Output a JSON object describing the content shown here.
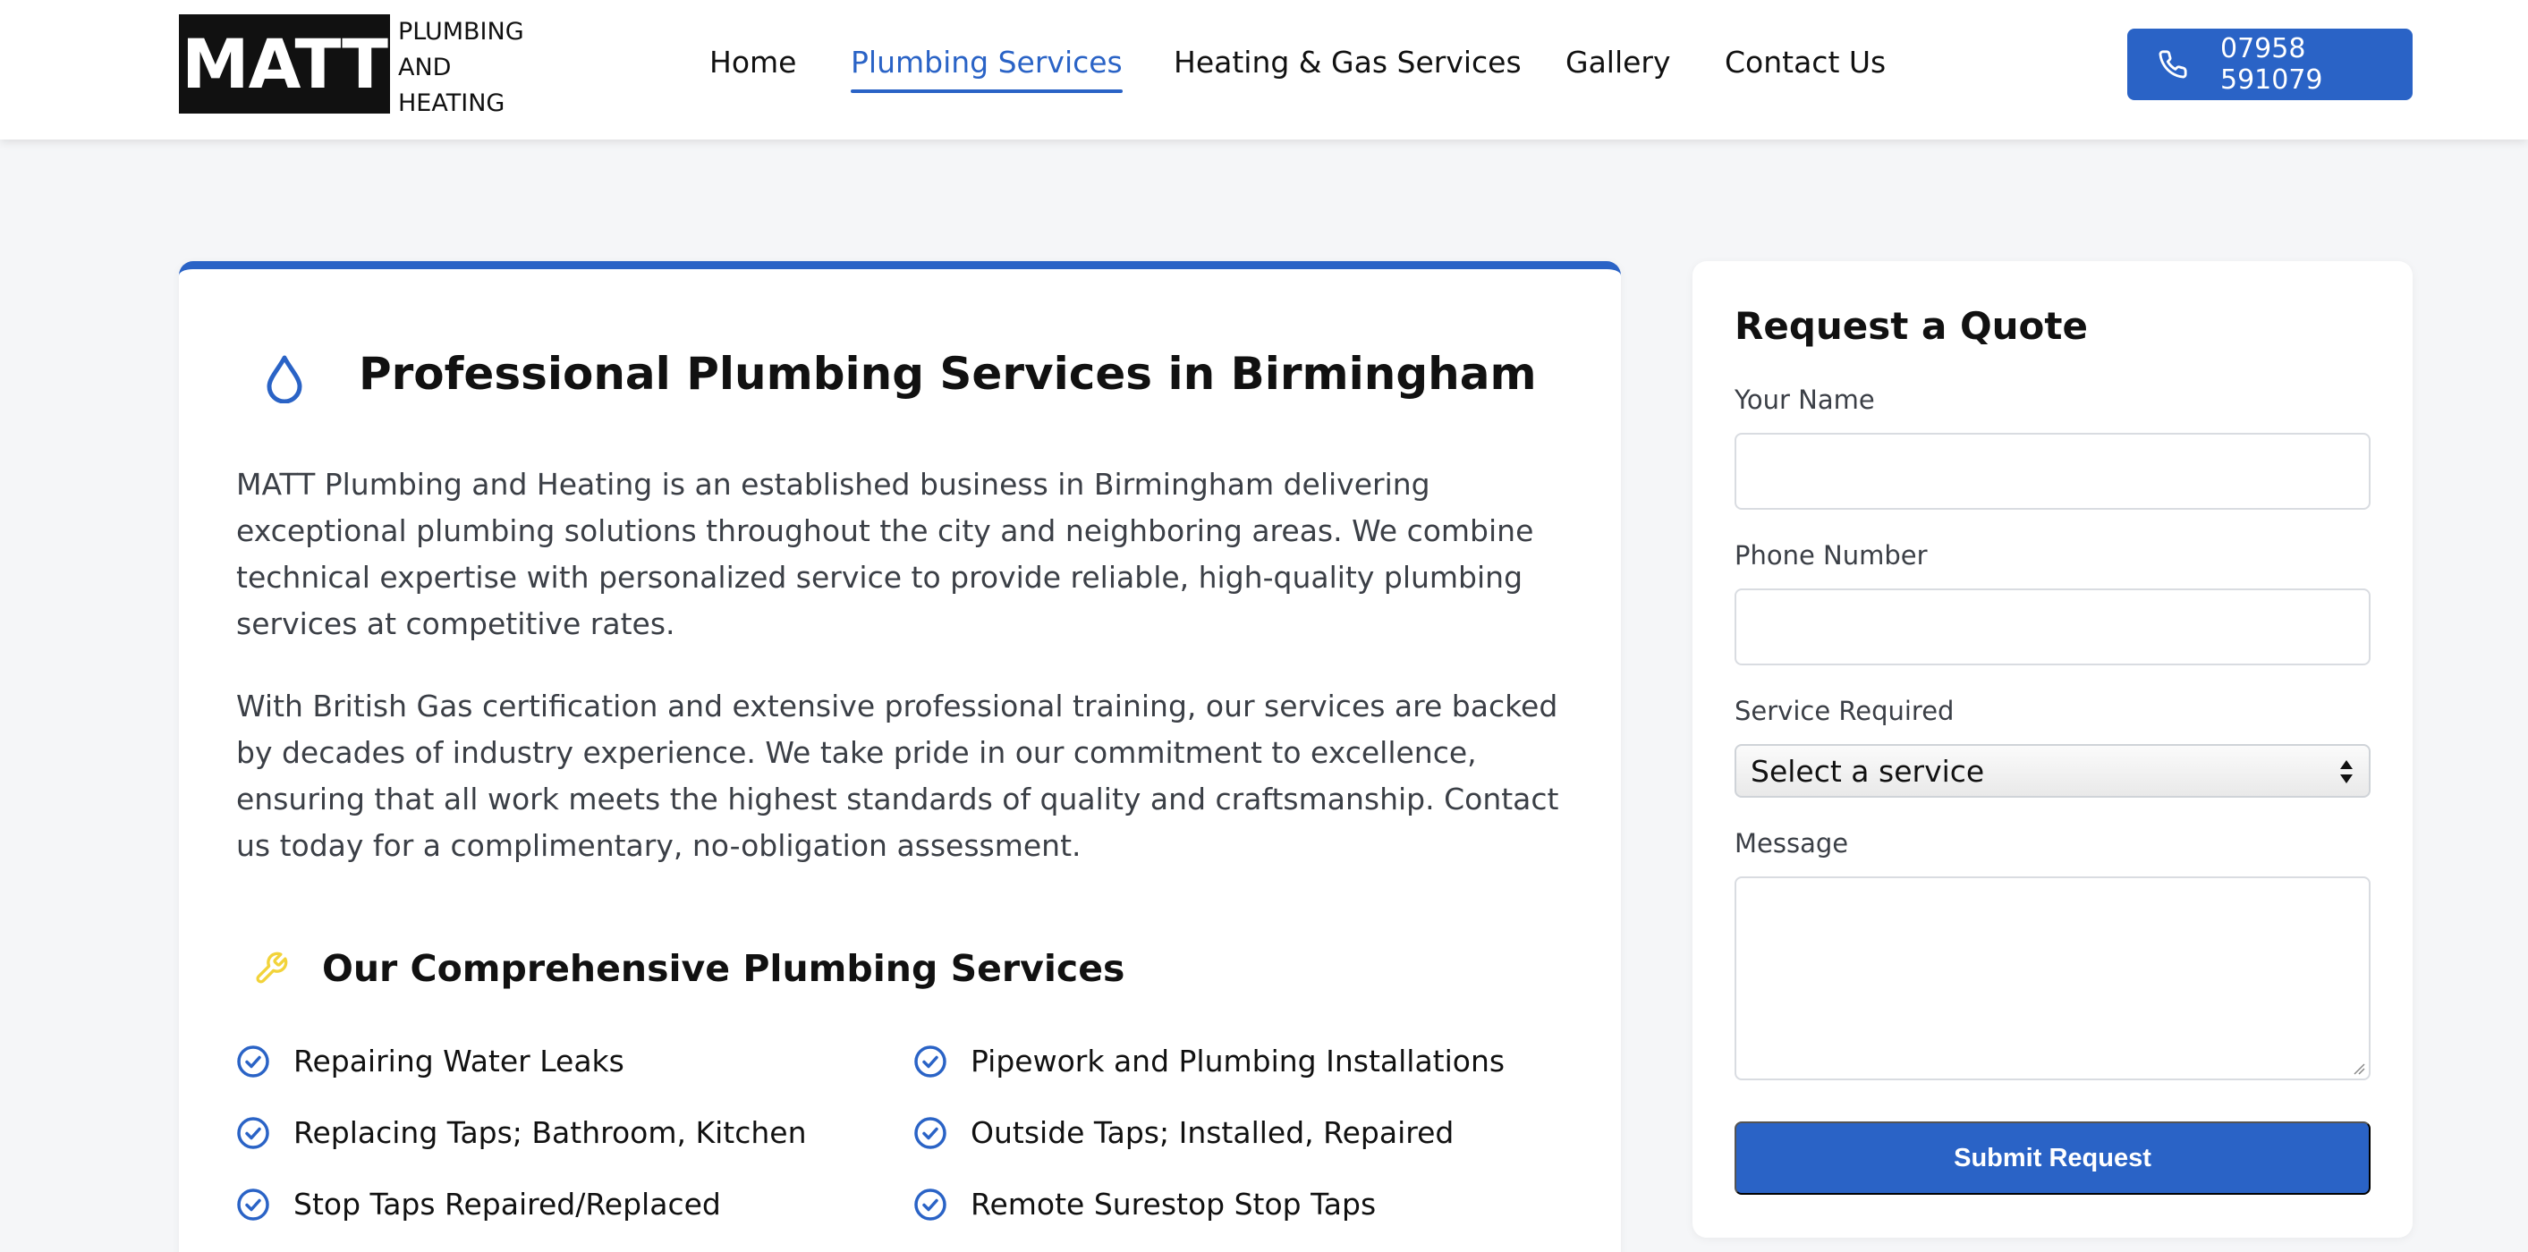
{
  "header": {
    "logo": {
      "mark": "MATT",
      "lines": [
        "PLUMBING",
        "AND",
        "HEATING"
      ]
    },
    "nav": [
      {
        "label": "Home",
        "active": false
      },
      {
        "label": "Plumbing Services",
        "active": true
      },
      {
        "label": "Heating & Gas Services",
        "active": false
      },
      {
        "label": "Gallery",
        "active": false
      },
      {
        "label": "Contact Us",
        "active": false
      }
    ],
    "phone": {
      "icon": "phone-icon",
      "label": "07958 591079"
    }
  },
  "main": {
    "title_icon": "water-drop-icon",
    "title": "Professional Plumbing Services in Birmingham",
    "paragraphs": [
      "MATT Plumbing and Heating is an established business in Birmingham delivering exceptional plumbing solutions throughout the city and neighboring areas. We combine technical expertise with personalized service to provide reliable, high-quality plumbing services at competitive rates.",
      "With British Gas certification and extensive professional training, our services are backed by decades of industry experience. We take pride in our commitment to excellence, ensuring that all work meets the highest standards of quality and craftsmanship. Contact us today for a complimentary, no-obligation assessment."
    ],
    "services_icon": "wrench-icon",
    "services_title": "Our Comprehensive Plumbing Services",
    "services": [
      "Repairing Water Leaks",
      "Pipework and Plumbing Installations",
      "Replacing Taps; Bathroom, Kitchen",
      "Outside Taps; Installed, Repaired",
      "Stop Taps Repaired/Replaced",
      "Remote Surestop Stop Taps"
    ]
  },
  "quote_form": {
    "title": "Request a Quote",
    "name_label": "Your Name",
    "name_value": "",
    "phone_label": "Phone Number",
    "phone_value": "",
    "service_label": "Service Required",
    "service_selected": "Select a service",
    "message_label": "Message",
    "message_value": "",
    "submit_label": "Submit Request"
  },
  "colors": {
    "accent": "#2a63c6",
    "wrench": "#f2d33a",
    "background": "#f5f6f8"
  }
}
